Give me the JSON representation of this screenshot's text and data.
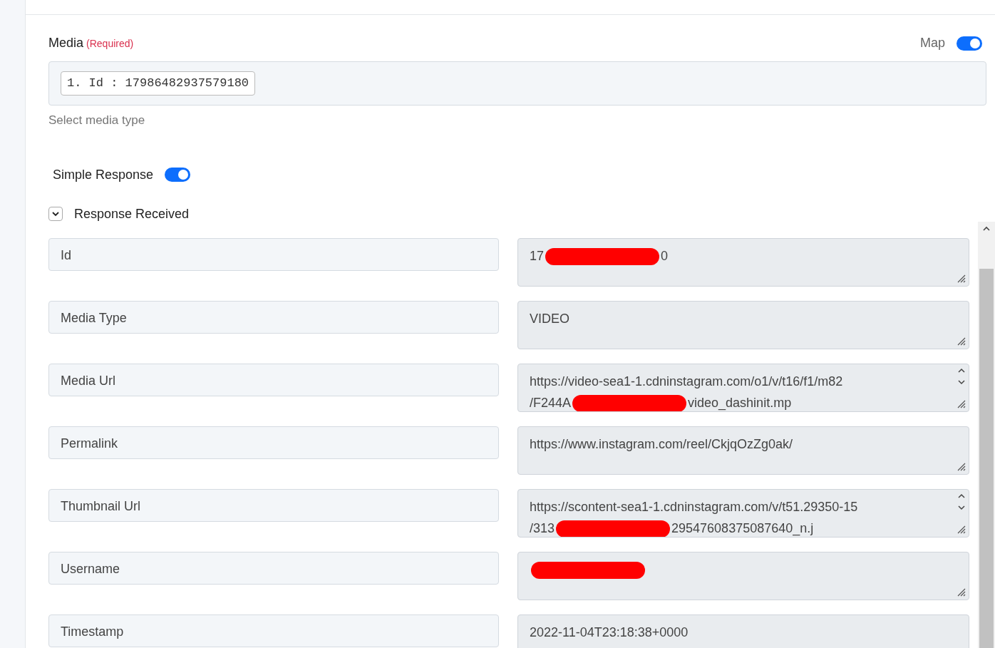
{
  "media_field": {
    "label": "Media",
    "required_note": "(Required)",
    "map_label": "Map",
    "map_on": true,
    "chip": "1. Id : 17986482937579180",
    "hint": "Select media type"
  },
  "simple_response": {
    "label": "Simple Response",
    "on": true
  },
  "response": {
    "label": "Response Received",
    "expanded": true,
    "rows": [
      {
        "name": "Id",
        "lines": [
          [
            {
              "kind": "text",
              "text": "17"
            },
            {
              "kind": "redaction"
            },
            {
              "kind": "text",
              "text": "0"
            }
          ]
        ],
        "scrollable": false
      },
      {
        "name": "Media Type",
        "lines": [
          [
            {
              "kind": "text",
              "text": "VIDEO"
            }
          ]
        ],
        "scrollable": false
      },
      {
        "name": "Media Url",
        "lines": [
          [
            {
              "kind": "text",
              "text": "https://video-sea1-1.cdninstagram.com/o1/v/t16/f1/m82"
            }
          ],
          [
            {
              "kind": "text",
              "text": "/F244A"
            },
            {
              "kind": "redaction"
            },
            {
              "kind": "text",
              "text": "video_dashinit.mp"
            }
          ]
        ],
        "scrollable": true
      },
      {
        "name": "Permalink",
        "lines": [
          [
            {
              "kind": "text",
              "text": "https://www.instagram.com/reel/CkjqOzZg0ak/"
            }
          ]
        ],
        "scrollable": false
      },
      {
        "name": "Thumbnail Url",
        "lines": [
          [
            {
              "kind": "text",
              "text": "https://scontent-sea1-1.cdninstagram.com/v/t51.29350-15"
            }
          ],
          [
            {
              "kind": "text",
              "text": "/313"
            },
            {
              "kind": "redaction"
            },
            {
              "kind": "text",
              "text": "29547608375087640_n.j"
            }
          ]
        ],
        "scrollable": true
      },
      {
        "name": "Username",
        "lines": [
          [
            {
              "kind": "redaction"
            }
          ]
        ],
        "scrollable": false
      },
      {
        "name": "Timestamp",
        "lines": [
          [
            {
              "kind": "text",
              "text": "2022-11-04T23:18:38+0000"
            }
          ]
        ],
        "scrollable": false
      }
    ]
  }
}
